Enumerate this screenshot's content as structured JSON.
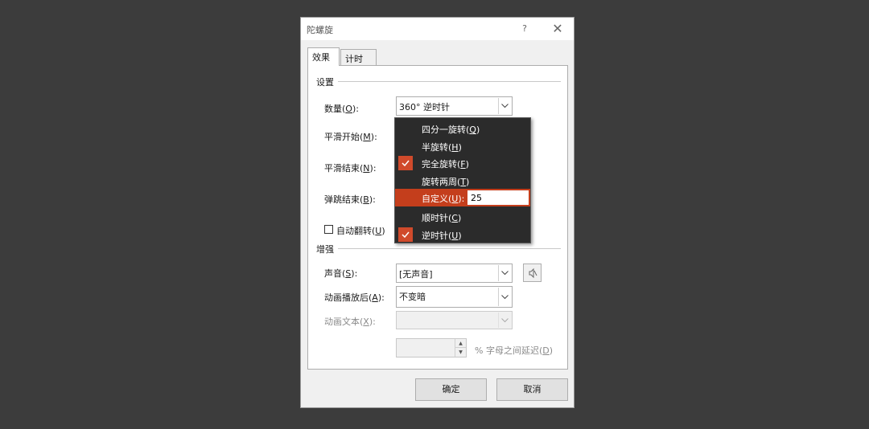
{
  "window": {
    "title": "陀螺旋",
    "help_label": "?",
    "close_label": "✕"
  },
  "tabs": [
    {
      "label": "效果",
      "active": true
    },
    {
      "label": "计时",
      "active": false
    }
  ],
  "settings": {
    "group_label": "设置",
    "amount": {
      "label": "数量(",
      "key": "O",
      "suffix": "):",
      "value": "360° 逆时针"
    },
    "smooth_start": {
      "label": "平滑开始(",
      "key": "M",
      "suffix": "):"
    },
    "smooth_end": {
      "label": "平滑结束(",
      "key": "N",
      "suffix": "):"
    },
    "bounce_end": {
      "label": "弹跳结束(",
      "key": "B",
      "suffix": "):"
    },
    "auto_reverse": {
      "label": "自动翻转(",
      "key": "U",
      "suffix": ")",
      "checked": false
    }
  },
  "enhancements": {
    "group_label": "增强",
    "sound": {
      "label": "声音(",
      "key": "S",
      "suffix": "):",
      "value": "[无声音]"
    },
    "after_animation": {
      "label": "动画播放后(",
      "key": "A",
      "suffix": "):",
      "value": "不变暗"
    },
    "animate_text": {
      "label": "动画文本(",
      "key": "X",
      "suffix": "):",
      "value": ""
    },
    "delay": {
      "value": "",
      "label": "% 字母之间延迟(",
      "key": "D",
      "suffix": ")"
    }
  },
  "buttons": {
    "ok": "确定",
    "cancel": "取消"
  },
  "menu": {
    "items": [
      {
        "label": "四分一旋转(",
        "key": "Q",
        "suffix": ")",
        "checked": false
      },
      {
        "label": "半旋转(",
        "key": "H",
        "suffix": ")",
        "checked": false
      },
      {
        "label": "完全旋转(",
        "key": "F",
        "suffix": ")",
        "checked": true
      },
      {
        "label": "旋转两周(",
        "key": "T",
        "suffix": ")",
        "checked": false
      },
      {
        "label": "自定义(",
        "key": "U",
        "suffix": "):",
        "checked": false,
        "highlighted": true,
        "input_value": "25"
      },
      {
        "label": "顺时针(",
        "key": "C",
        "suffix": ")",
        "checked": false
      },
      {
        "label": "逆时针(",
        "key": "U",
        "suffix": ")",
        "checked": true
      }
    ]
  },
  "colors": {
    "accent": "#c43e1c",
    "check_bg": "#d04a2b",
    "menu_bg": "#2b2b2b",
    "backdrop": "#3c3c3c"
  }
}
